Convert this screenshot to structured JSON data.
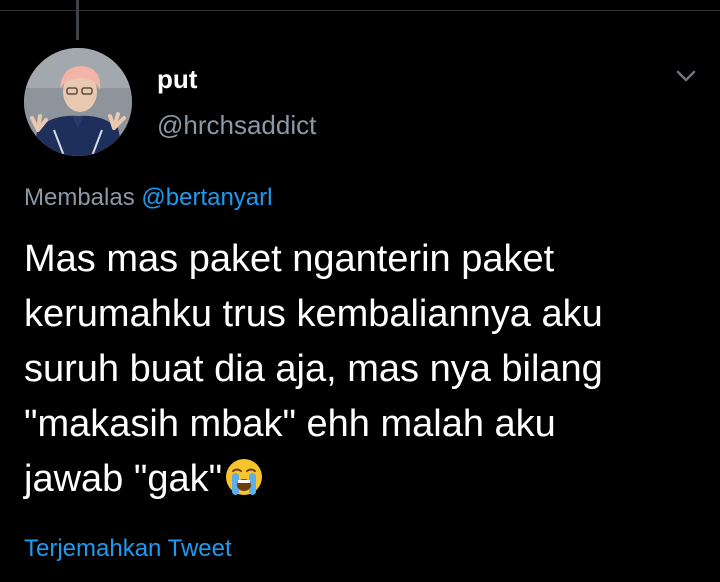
{
  "tweet": {
    "display_name": "put",
    "handle": "@hrchsaddict",
    "reply_prefix": "Membalas",
    "reply_mention": "@bertanyarl",
    "text_lines": [
      "Mas mas paket nganterin paket",
      "kerumahku trus kembaliannya aku",
      "suruh buat dia aja, mas nya bilang",
      "\"makasih mbak\" ehh malah aku",
      "jawab \"gak\""
    ],
    "emoji": "loudly-crying-face",
    "translate_label": "Terjemahkan Tweet"
  },
  "icons": {
    "menu": "chevron-down-icon",
    "emoji": "loudly-crying-face-icon"
  },
  "colors": {
    "background": "#000000",
    "text_primary": "#ffffff",
    "text_secondary": "#8b98a5",
    "accent": "#1d9bf0"
  }
}
